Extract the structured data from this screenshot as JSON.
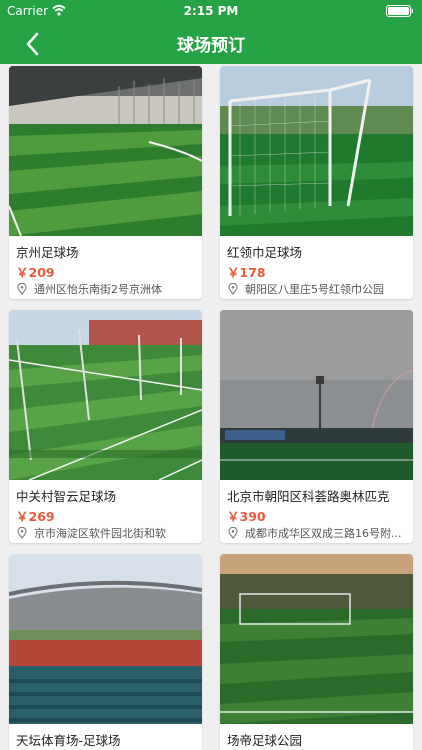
{
  "status_bar": {
    "carrier": "Carrier",
    "time": "2:15 PM"
  },
  "header": {
    "title": "球场预订"
  },
  "venues": [
    {
      "name": "京州足球场",
      "price": "￥209",
      "address": "通州区怡乐南街2号京洲体"
    },
    {
      "name": "红领巾足球场",
      "price": "￥178",
      "address": "朝阳区八里庄5号红领巾公园"
    },
    {
      "name": "中关村智云足球场",
      "price": "￥269",
      "address": "京市海淀区软件园北街和软"
    },
    {
      "name": "北京市朝阳区科荟路奥林匹克",
      "price": "￥390",
      "address": "成都市成华区双成三路16号附..."
    },
    {
      "name": "天坛体育场-足球场",
      "price": "",
      "address": ""
    },
    {
      "name": "场帝足球公园",
      "price": "",
      "address": ""
    }
  ],
  "colors": {
    "brand": "#25a244",
    "price": "#e85a3c"
  }
}
